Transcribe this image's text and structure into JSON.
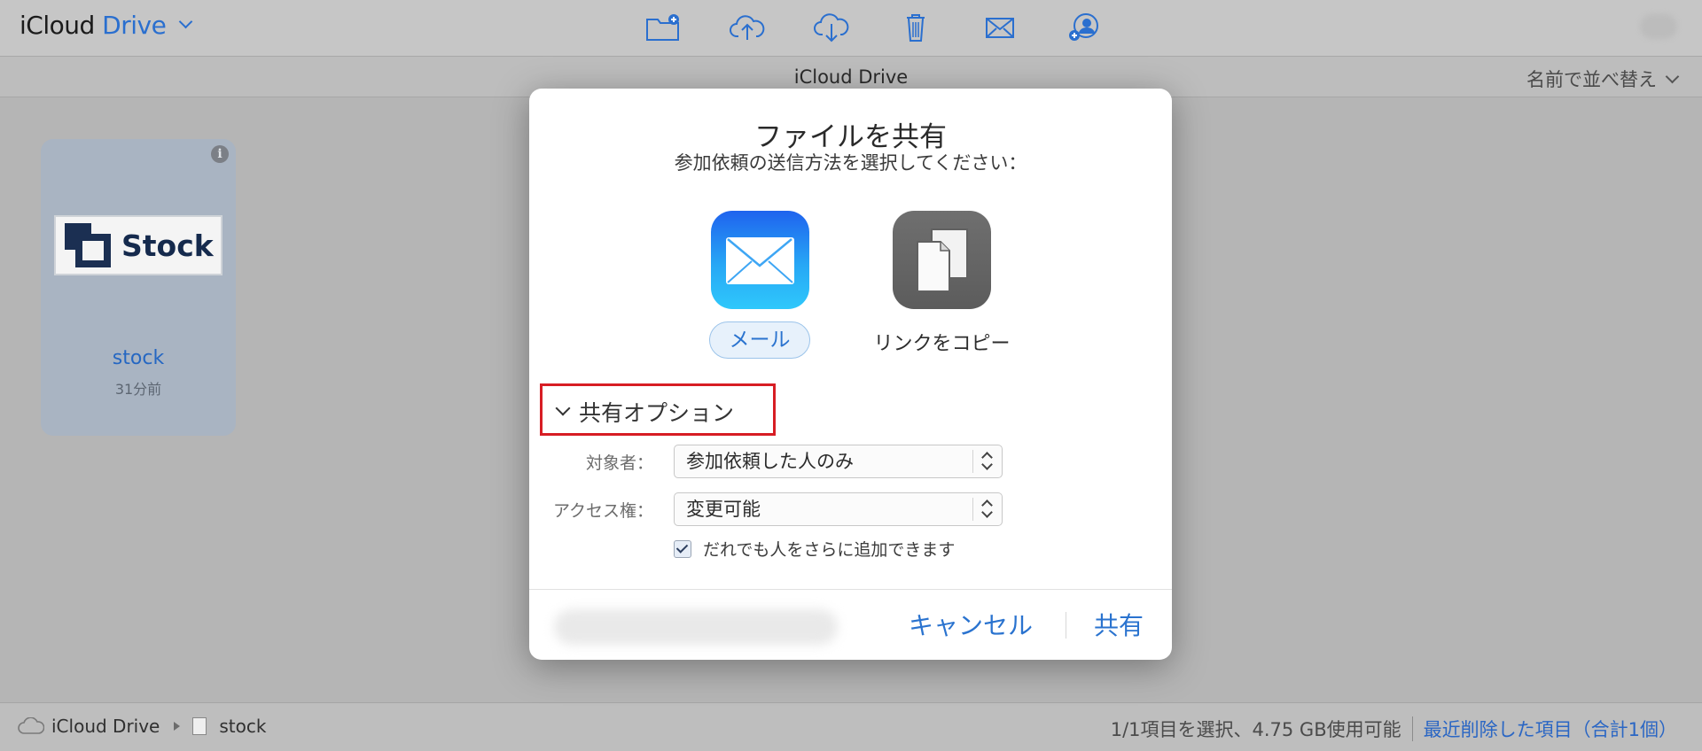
{
  "header": {
    "brand_prefix": "iCloud",
    "brand_suffix": "Drive",
    "toolbar": [
      {
        "icon": "new-folder-icon"
      },
      {
        "icon": "upload-icon"
      },
      {
        "icon": "download-icon"
      },
      {
        "icon": "trash-icon"
      },
      {
        "icon": "mail-icon"
      },
      {
        "icon": "add-people-icon"
      }
    ]
  },
  "subheader": {
    "title": "iCloud Drive",
    "sort_label": "名前で並べ替え"
  },
  "file_tile": {
    "logo_text": "Stock",
    "name": "stock",
    "modified": "31分前",
    "info_glyph": "i"
  },
  "dialog": {
    "title": "ファイルを共有",
    "subtitle": "参加依頼の送信方法を選択してください：",
    "methods": [
      {
        "label": "メール",
        "selected": true,
        "icon": "mail-app-icon"
      },
      {
        "label": "リンクをコピー",
        "selected": false,
        "icon": "copy-link-icon"
      }
    ],
    "share_options_label": "共有オプション",
    "audience_label": "対象者：",
    "audience_value": "参加依頼した人のみ",
    "access_label": "アクセス権：",
    "access_value": "変更可能",
    "allow_add_label": "だれでも人をさらに追加できます",
    "allow_add_checked": true,
    "cancel_label": "キャンセル",
    "share_label": "共有"
  },
  "footer": {
    "path": [
      "iCloud Drive",
      "stock"
    ],
    "status": "1/1項目を選択、4.75 GB使用可能",
    "recently_deleted": "最近削除した項目（合計1個）"
  },
  "colors": {
    "accent": "#2a73cf",
    "highlight_border": "#d71d24"
  }
}
